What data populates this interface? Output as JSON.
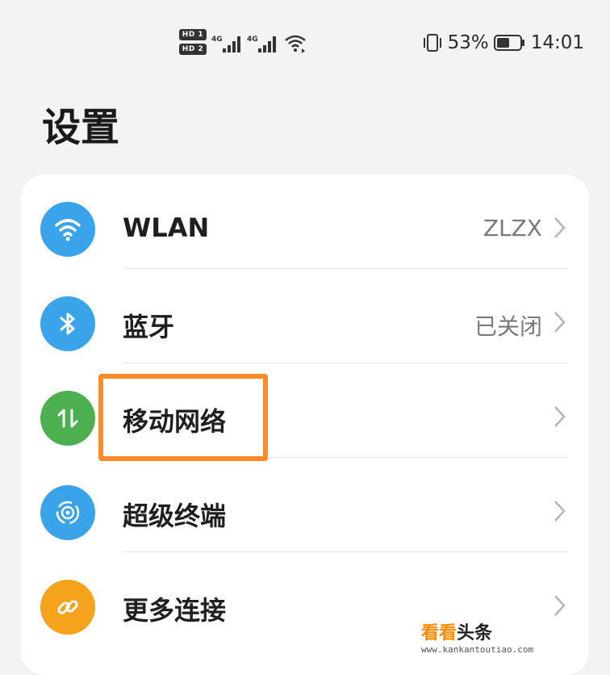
{
  "status_bar": {
    "sim1_badge": "HD 1",
    "sim2_badge": "HD 2",
    "sim1_network": "4G",
    "sim2_network": "4G",
    "battery_percent": "53%",
    "time": "14:01"
  },
  "page_title": "设置",
  "settings": [
    {
      "label": "WLAN",
      "value": "ZLZX",
      "icon": "wifi-icon",
      "color": "#3aa4ea"
    },
    {
      "label": "蓝牙",
      "value": "已关闭",
      "icon": "bluetooth-icon",
      "color": "#3aa4ea"
    },
    {
      "label": "移动网络",
      "value": "",
      "icon": "mobile-data-icon",
      "color": "#4caf50"
    },
    {
      "label": "超级终端",
      "value": "",
      "icon": "super-device-icon",
      "color": "#3aa4ea"
    },
    {
      "label": "更多连接",
      "value": "",
      "icon": "link-icon",
      "color": "#f5a21c"
    }
  ],
  "watermark": {
    "main_orange": "看看",
    "main_dark": "头条",
    "sub": "www.kankantoutiao.com"
  }
}
